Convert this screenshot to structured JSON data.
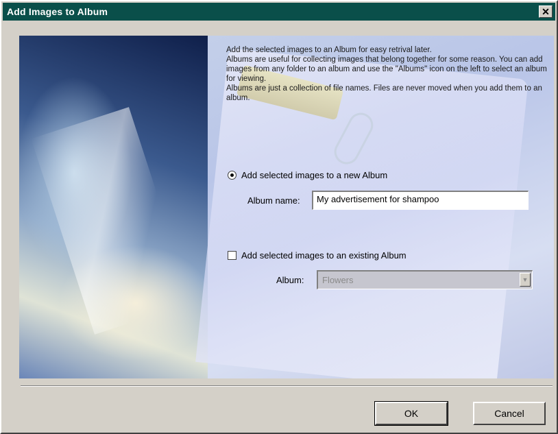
{
  "window": {
    "title": "Add Images to Album",
    "close_glyph": "✕"
  },
  "info": {
    "line1": "Add the selected images to an Album for easy retrival later.",
    "line2": "Albums are useful for collecting images that belong together for some reason. You can add images from any folder to an album and use the \"Albums\" icon on the left to select an album for viewing.",
    "line3": "Albums are just a collection of file names. Files are never moved when you add them to an album."
  },
  "new_album": {
    "option_label": "Add selected images to a new Album",
    "selected": true,
    "name_label": "Album name:",
    "name_value": "My advertisement for shampoo"
  },
  "existing_album": {
    "option_label": "Add selected images to an existing Album",
    "selected": false,
    "album_label": "Album:",
    "album_value": "Flowers"
  },
  "buttons": {
    "ok": "OK",
    "cancel": "Cancel"
  },
  "icons": {
    "close": "close-icon",
    "dropdown": "chevron-down-icon"
  }
}
